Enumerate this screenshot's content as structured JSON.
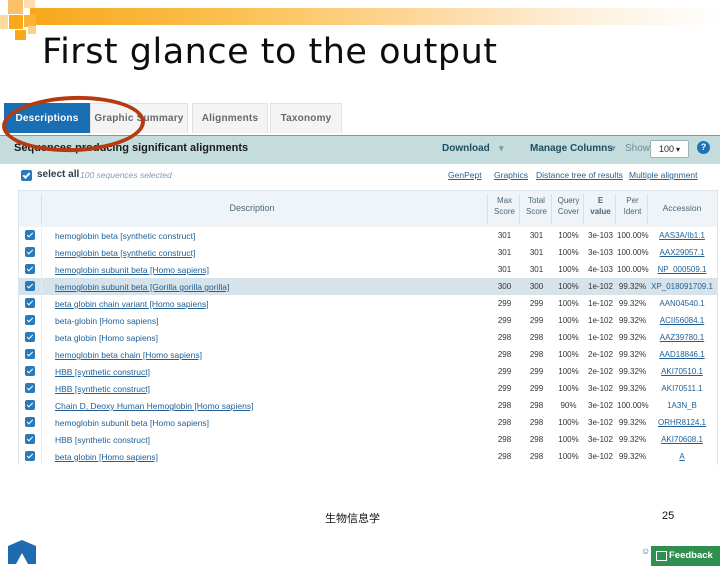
{
  "slide": {
    "title": "First glance to the output",
    "footer_subject": "生物信息学",
    "page_number": "25",
    "accent_orange": "#f7a81b",
    "annotation_color": "#b7390f"
  },
  "browser": {
    "tabs": [
      {
        "label": "Descriptions",
        "active": true
      },
      {
        "label": "Graphic Summary",
        "active": false
      },
      {
        "label": "Alignments",
        "active": false
      },
      {
        "label": "Taxonomy",
        "active": false
      }
    ],
    "toolbar": {
      "heading": "Sequences producing significant alignments",
      "download_label": "Download",
      "manage_columns_label": "Manage Columns",
      "show_label": "Show",
      "show_value": "100",
      "caret": "▾",
      "help_label": "?"
    },
    "select_bar": {
      "select_all_label": "select all",
      "selection_count": "100 sequences selected",
      "links": [
        "GenPept",
        "Graphics",
        "Distance tree of results",
        "Multiple alignment"
      ]
    },
    "table": {
      "headers": {
        "description": "Description",
        "max_score": [
          "Max",
          "Score"
        ],
        "total_score": [
          "Total",
          "Score"
        ],
        "query_cover": [
          "Query",
          "Cover"
        ],
        "e_value": [
          "E",
          "value"
        ],
        "per_ident": [
          "Per",
          "Ident"
        ],
        "accession": "Accession"
      },
      "rows": [
        {
          "desc": "hemoglobin beta [synthetic construct]",
          "link": false,
          "max": "301",
          "total": "301",
          "cover": "100%",
          "evalue": "3e-103",
          "ident": "100.00%",
          "acc": "AAS3A/Ib1.1",
          "acc_link": true,
          "hl": false
        },
        {
          "desc": "hemoglobin beta [synthetic construct]",
          "link": true,
          "max": "301",
          "total": "301",
          "cover": "100%",
          "evalue": "3e-103",
          "ident": "100.00%",
          "acc": "AAX29057.1",
          "acc_link": true,
          "hl": false
        },
        {
          "desc": "hemoglobin subunit beta [Homo sapiens]",
          "link": true,
          "max": "301",
          "total": "301",
          "cover": "100%",
          "evalue": "4e-103",
          "ident": "100.00%",
          "acc": "NP_000509.1",
          "acc_link": true,
          "hl": false
        },
        {
          "desc": "hemoglobin subunit beta [Gorilla gorilla gorilla]",
          "link": true,
          "max": "300",
          "total": "300",
          "cover": "100%",
          "evalue": "1e-102",
          "ident": "99.32%",
          "acc": "XP_018091709.1",
          "acc_link": false,
          "hl": true
        },
        {
          "desc": "beta globin chain variant [Homo sapiens]",
          "link": true,
          "max": "299",
          "total": "299",
          "cover": "100%",
          "evalue": "1e-102",
          "ident": "99.32%",
          "acc": "AAN04540.1",
          "acc_link": false,
          "hl": false
        },
        {
          "desc": "beta-globin [Homo sapiens]",
          "link": false,
          "max": "299",
          "total": "299",
          "cover": "100%",
          "evalue": "1e-102",
          "ident": "99.32%",
          "acc": "ACII56084.1",
          "acc_link": true,
          "hl": false
        },
        {
          "desc": "beta globin [Homo sapiens]",
          "link": false,
          "max": "298",
          "total": "298",
          "cover": "100%",
          "evalue": "1e-102",
          "ident": "99.32%",
          "acc": "AAZ39780.1",
          "acc_link": true,
          "hl": false
        },
        {
          "desc": "hemoglobin beta chain [Homo sapiens]",
          "link": true,
          "max": "298",
          "total": "298",
          "cover": "100%",
          "evalue": "2e-102",
          "ident": "99.32%",
          "acc": "AAD18846.1",
          "acc_link": true,
          "hl": false
        },
        {
          "desc": "HBB [synthetic construct]",
          "link": true,
          "max": "299",
          "total": "299",
          "cover": "100%",
          "evalue": "2e-102",
          "ident": "99.32%",
          "acc": "AKI70510.1",
          "acc_link": true,
          "hl": false
        },
        {
          "desc": "HBB [synthetic construct]",
          "link": true,
          "max": "299",
          "total": "299",
          "cover": "100%",
          "evalue": "3e-102",
          "ident": "99.32%",
          "acc": "AKI70511.1",
          "acc_link": false,
          "hl": false
        },
        {
          "desc": "Chain D, Deoxy Human Hemoglobin [Homo sapiens]",
          "link": true,
          "max": "298",
          "total": "298",
          "cover": "90%",
          "evalue": "3e-102",
          "ident": "100.00%",
          "acc": "1A3N_B",
          "acc_link": false,
          "hl": false
        },
        {
          "desc": "hemoglobin subunit beta [Homo sapiens]",
          "link": false,
          "max": "298",
          "total": "298",
          "cover": "100%",
          "evalue": "3e-102",
          "ident": "99.32%",
          "acc": "ORHR8124.1",
          "acc_link": true,
          "hl": false
        },
        {
          "desc": "HBB [synthetic construct]",
          "link": false,
          "max": "298",
          "total": "298",
          "cover": "100%",
          "evalue": "3e-102",
          "ident": "99.32%",
          "acc": "AKI70608.1",
          "acc_link": true,
          "hl": false
        },
        {
          "desc": "beta globin [Homo sapiens]",
          "link": true,
          "max": "298",
          "total": "298",
          "cover": "100%",
          "evalue": "3e-102",
          "ident": "99.32%",
          "acc": "A",
          "acc_link": true,
          "hl": false
        }
      ]
    },
    "feedback_label": "Feedback",
    "scroll_top_label": "scroll to top"
  }
}
